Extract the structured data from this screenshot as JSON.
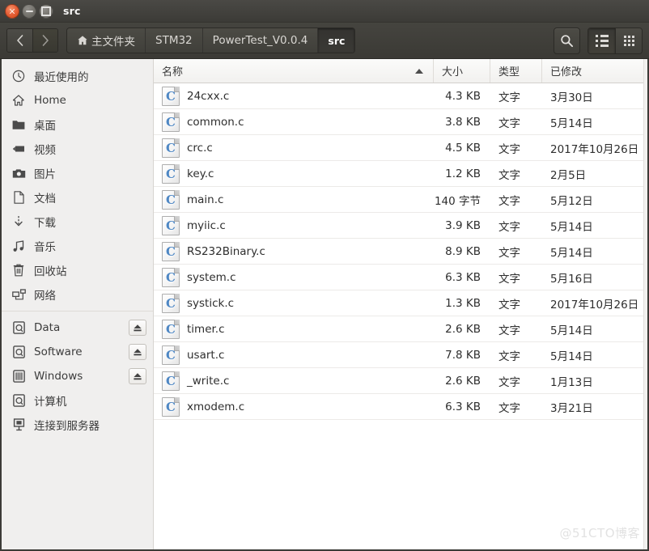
{
  "window": {
    "title": "src",
    "controls": [
      {
        "name": "close",
        "label": "×"
      },
      {
        "name": "minimize",
        "label": "−"
      },
      {
        "name": "maximize",
        "label": "□"
      }
    ]
  },
  "toolbar": {
    "back_label": "‹",
    "forward_label": "›",
    "breadcrumbs": [
      {
        "label": "主文件夹",
        "icon": "home-icon",
        "active": false
      },
      {
        "label": "STM32",
        "icon": "",
        "active": false
      },
      {
        "label": "PowerTest_V0.0.4",
        "icon": "",
        "active": false
      },
      {
        "label": "src",
        "icon": "",
        "active": true
      }
    ],
    "search_label": "search-icon",
    "view_list_label": "list-view-icon",
    "view_grid_label": "grid-view-icon"
  },
  "sidebar": {
    "items": [
      {
        "label": "最近使用的",
        "icon": "clock-icon",
        "eject": false
      },
      {
        "label": "Home",
        "icon": "home-icon",
        "eject": false
      },
      {
        "label": "桌面",
        "icon": "folder-icon",
        "eject": false
      },
      {
        "label": "视频",
        "icon": "video-icon",
        "eject": false
      },
      {
        "label": "图片",
        "icon": "camera-icon",
        "eject": false
      },
      {
        "label": "文档",
        "icon": "document-icon",
        "eject": false
      },
      {
        "label": "下载",
        "icon": "download-icon",
        "eject": false
      },
      {
        "label": "音乐",
        "icon": "music-icon",
        "eject": false
      },
      {
        "label": "回收站",
        "icon": "trash-icon",
        "eject": false
      },
      {
        "label": "网络",
        "icon": "network-icon",
        "eject": false
      }
    ],
    "devices": [
      {
        "label": "Data",
        "icon": "drive-icon",
        "eject": true
      },
      {
        "label": "Software",
        "icon": "drive-icon",
        "eject": true
      },
      {
        "label": "Windows",
        "icon": "windows-drive-icon",
        "eject": true
      },
      {
        "label": "计算机",
        "icon": "drive-icon",
        "eject": false
      },
      {
        "label": "连接到服务器",
        "icon": "server-icon",
        "eject": false
      }
    ]
  },
  "file_list": {
    "columns": {
      "name": "名称",
      "size": "大小",
      "type": "类型",
      "modified": "已修改"
    },
    "sort": {
      "column": "名称",
      "direction": "asc"
    },
    "rows": [
      {
        "name": "24cxx.c",
        "size": "4.3 KB",
        "type": "文字",
        "modified": "3月30日",
        "icon": "c-file-icon",
        "letter": "C"
      },
      {
        "name": "common.c",
        "size": "3.8 KB",
        "type": "文字",
        "modified": "5月14日",
        "icon": "c-file-icon",
        "letter": "C"
      },
      {
        "name": "crc.c",
        "size": "4.5 KB",
        "type": "文字",
        "modified": "2017年10月26日",
        "icon": "c-file-icon",
        "letter": "C"
      },
      {
        "name": "key.c",
        "size": "1.2 KB",
        "type": "文字",
        "modified": "2月5日",
        "icon": "c-file-icon",
        "letter": "C"
      },
      {
        "name": "main.c",
        "size": "140 字节",
        "type": "文字",
        "modified": "5月12日",
        "icon": "c-file-icon",
        "letter": "C"
      },
      {
        "name": "myiic.c",
        "size": "3.9 KB",
        "type": "文字",
        "modified": "5月14日",
        "icon": "c-file-icon",
        "letter": "C"
      },
      {
        "name": "RS232Binary.c",
        "size": "8.9 KB",
        "type": "文字",
        "modified": "5月14日",
        "icon": "c-file-icon",
        "letter": "C"
      },
      {
        "name": "system.c",
        "size": "6.3 KB",
        "type": "文字",
        "modified": "5月16日",
        "icon": "c-file-icon",
        "letter": "C"
      },
      {
        "name": "systick.c",
        "size": "1.3 KB",
        "type": "文字",
        "modified": "2017年10月26日",
        "icon": "c-file-icon",
        "letter": "C"
      },
      {
        "name": "timer.c",
        "size": "2.6 KB",
        "type": "文字",
        "modified": "5月14日",
        "icon": "c-file-icon",
        "letter": "C"
      },
      {
        "name": "usart.c",
        "size": "7.8 KB",
        "type": "文字",
        "modified": "5月14日",
        "icon": "c-file-icon",
        "letter": "C"
      },
      {
        "name": "_write.c",
        "size": "2.6 KB",
        "type": "文字",
        "modified": "1月13日",
        "icon": "c-file-icon",
        "letter": "C"
      },
      {
        "name": "xmodem.c",
        "size": "6.3 KB",
        "type": "文字",
        "modified": "3月21日",
        "icon": "c-file-icon",
        "letter": "C"
      }
    ]
  },
  "watermark": {
    "text": "@51CTO博客"
  },
  "colors": {
    "titlebar": "#3c3b37",
    "toolbar": "#413f3a",
    "sidebar_bg": "#f0efee",
    "pane_bg": "#ffffff",
    "close_button": "#e8633c",
    "c_letter": "#4e87c4"
  }
}
